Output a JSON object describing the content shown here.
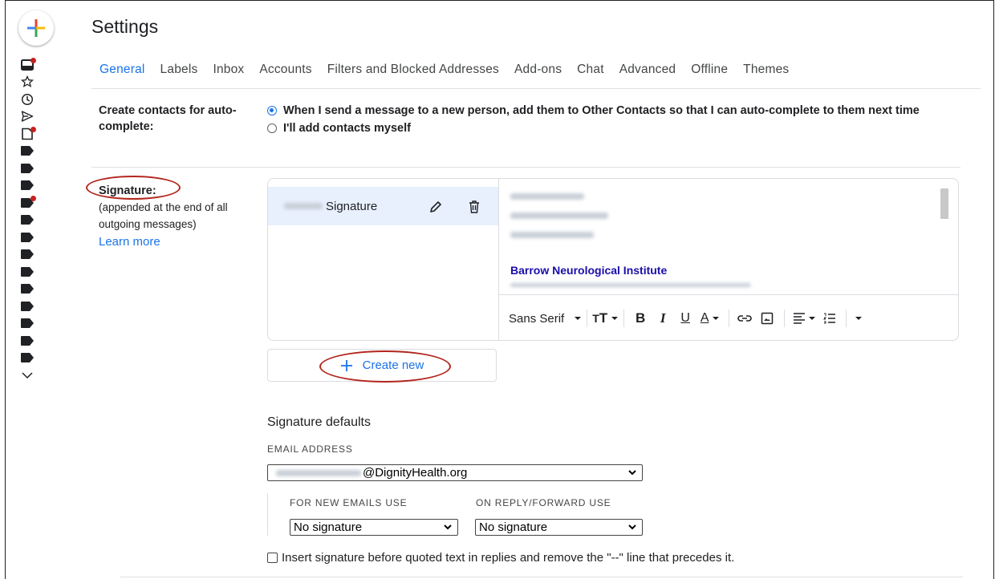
{
  "header": {
    "title": "Settings"
  },
  "tabs": [
    "General",
    "Labels",
    "Inbox",
    "Accounts",
    "Filters and Blocked Addresses",
    "Add-ons",
    "Chat",
    "Advanced",
    "Offline",
    "Themes"
  ],
  "colors": {
    "accent": "#1a73e8",
    "annotation": "#b3261e",
    "selected_row": "#e8f0fe",
    "link_dark": "#1a0dab"
  },
  "rail_icons": [
    "compose-plus-icon",
    "inbox-icon",
    "star-icon",
    "clock-icon",
    "send-icon",
    "draft-icon",
    "label-icon",
    "chevron-down-icon"
  ],
  "autocomplete": {
    "label": "Create contacts for auto-complete:",
    "option_on": "When I send a message to a new person, add them to Other Contacts so that I can auto-complete to them next time",
    "option_off": "I'll add contacts myself"
  },
  "signature": {
    "label": "Signature:",
    "desc": "(appended at the end of all outgoing messages)",
    "learn_more": "Learn more",
    "item_name": "Signature",
    "editor_org": "Barrow Neurological Institute",
    "font": "Sans Serif",
    "create_new": "Create new"
  },
  "defaults": {
    "heading": "Signature defaults",
    "email_label": "EMAIL ADDRESS",
    "email_value": "@DignityHealth.org",
    "new_label": "FOR NEW EMAILS USE",
    "new_value": "No signature",
    "reply_label": "ON REPLY/FORWARD USE",
    "reply_value": "No signature",
    "insert_text": "Insert signature before quoted text in replies and remove the \"--\" line that precedes it."
  }
}
